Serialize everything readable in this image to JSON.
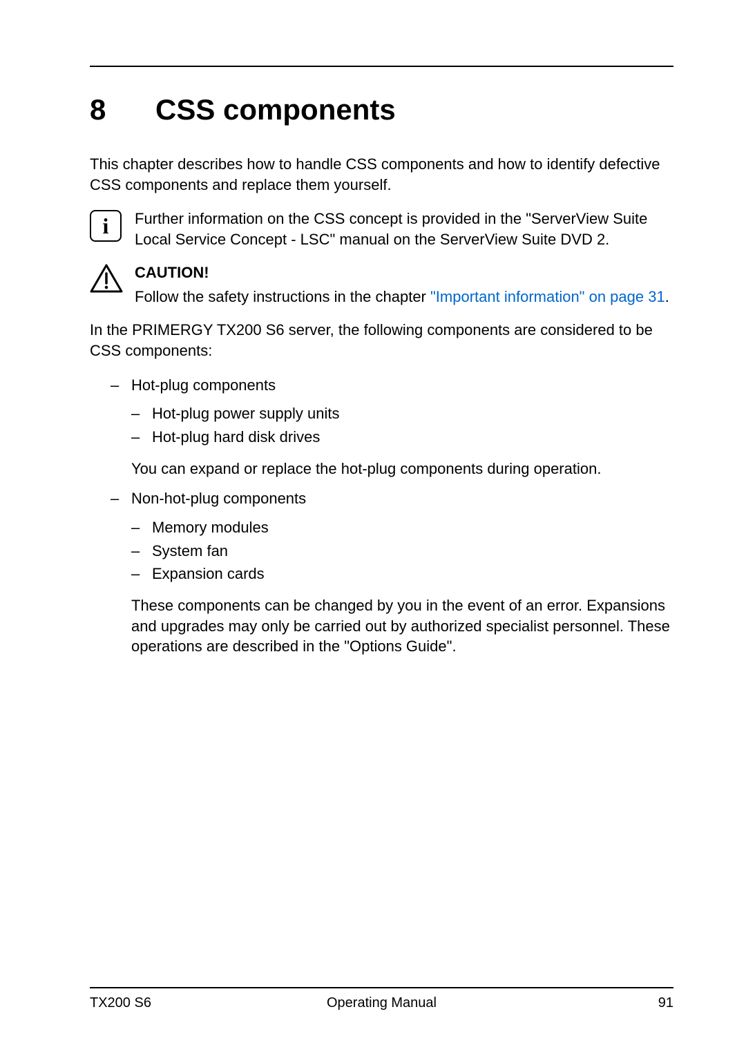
{
  "chapter": {
    "number": "8",
    "title": "CSS components"
  },
  "intro": "This chapter describes how to handle CSS components and how to identify defective CSS components and replace them yourself.",
  "info_note": "Further information on the CSS concept is provided in the \"ServerView Suite Local Service Concept - LSC\" manual on the ServerView Suite DVD 2.",
  "caution": {
    "heading": "CAUTION!",
    "text_before_link": "Follow the safety instructions in the chapter ",
    "link_text": "\"Important information\" on page 31",
    "text_after_link": "."
  },
  "body_after_caution": "In the PRIMERGY TX200 S6 server, the following components are considered to be CSS components:",
  "list": [
    {
      "label": "Hot-plug components",
      "subitems": [
        "Hot-plug power supply units",
        "Hot-plug hard disk drives"
      ],
      "note": "You can expand or replace the hot-plug components during operation."
    },
    {
      "label": "Non-hot-plug components",
      "subitems": [
        "Memory modules",
        "System fan",
        "Expansion cards"
      ],
      "note": "These components can be changed by you in the event of an error. Expansions and upgrades may only be carried out by authorized specialist personnel. These operations are described in the \"Options Guide\"."
    }
  ],
  "footer": {
    "left": "TX200 S6",
    "center": "Operating Manual",
    "right": "91"
  }
}
